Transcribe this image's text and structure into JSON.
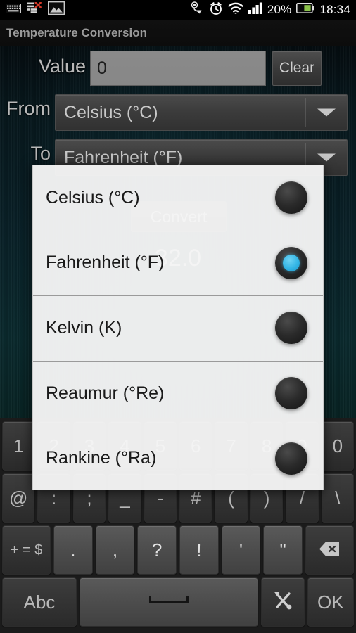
{
  "status_bar": {
    "left_icons": [
      "keyboard-icon",
      "list-error-icon",
      "picture-icon"
    ],
    "right_icons": [
      "sync-icon",
      "alarm-clock-icon",
      "wifi-icon",
      "signal-bars-icon",
      "battery-icon"
    ],
    "battery_percent": "20%",
    "time": "18:34"
  },
  "app": {
    "title": "Temperature Conversion",
    "accent_color": "#33b5e5",
    "background_color": "#0a2128"
  },
  "form": {
    "value_label": "Value",
    "value_text": "0",
    "value_placeholder": "0",
    "clear_label": "Clear",
    "from_label": "From",
    "from_selected": "Celsius (°C)",
    "to_label": "To",
    "to_selected": "Fahrenheit (°F)",
    "convert_label": "Convert",
    "result_text": "32.0"
  },
  "dialog": {
    "options": [
      {
        "label": "Celsius (°C)",
        "selected": false
      },
      {
        "label": "Fahrenheit (°F)",
        "selected": true
      },
      {
        "label": "Kelvin (K)",
        "selected": false
      },
      {
        "label": "Reaumur (°Re)",
        "selected": false
      },
      {
        "label": "Rankine (°Ra)",
        "selected": false
      }
    ]
  },
  "keyboard": {
    "row_numbers": [
      "1",
      "2",
      "3",
      "4",
      "5",
      "6",
      "7",
      "8",
      "9",
      "0"
    ],
    "row_symbols": [
      "@",
      ":",
      ";",
      "_",
      "-",
      "#",
      "(",
      ")",
      "/",
      "\\"
    ],
    "row_punct_mod": "+ = $",
    "row_punct": [
      ".",
      ",",
      "?",
      "!",
      "'",
      "\""
    ],
    "backspace_label": "⌫",
    "abc_label": "Abc",
    "space_label": "",
    "tools_label": "⚒",
    "ok_label": "OK"
  }
}
